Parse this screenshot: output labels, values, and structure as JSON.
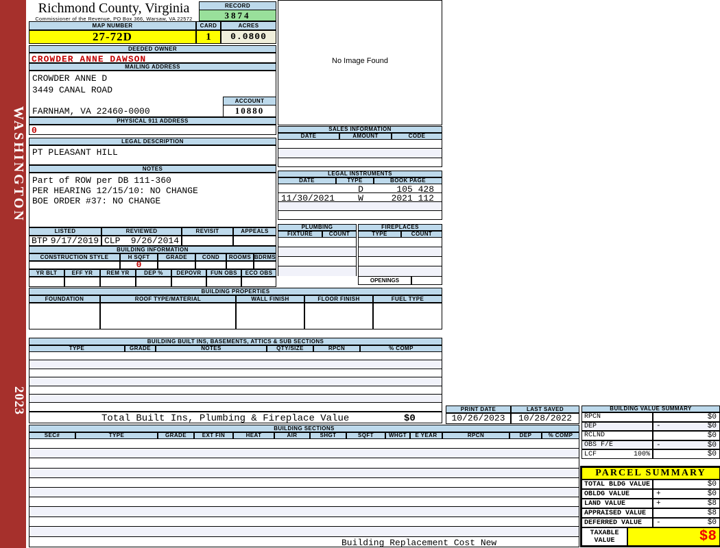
{
  "sidebar": {
    "state": "WASHINGTON",
    "year": "2023"
  },
  "header": {
    "county": "Richmond County, Virginia",
    "office_line": "Commissioner of the Revenue, PO Box 366, Warsaw, VA 22572",
    "record": {
      "label": "RECORD",
      "value": "3874"
    },
    "map_number": {
      "label": "MAP NUMBER",
      "value": "27-72D"
    },
    "card": {
      "label": "CARD",
      "value": "1"
    },
    "acres": {
      "label": "ACRES",
      "value": "0.0800"
    }
  },
  "owner": {
    "deeded_owner_label": "DEEDED OWNER",
    "deeded_owner": "CROWDER ANNE DAWSON",
    "mailing_label": "MAILING ADDRESS",
    "mailing_line1": "CROWDER ANNE D",
    "mailing_line2": "3449 CANAL ROAD",
    "mailing_line3": "FARNHAM, VA 22460-0000",
    "account_label": "ACCOUNT",
    "account": "10880",
    "physical_label": "PHYSICAL 911 ADDRESS",
    "physical_value": "0",
    "legal_label": "LEGAL DESCRIPTION",
    "legal_description": "PT PLEASANT HILL",
    "notes_label": "NOTES",
    "notes_line1": "Part of ROW per DB 111-360",
    "notes_line2": "PER HEARING 12/15/10: NO CHANGE",
    "notes_line3": "BOE ORDER #37: NO CHANGE"
  },
  "review": {
    "headers": [
      "LISTED",
      "REVIEWED",
      "REVISIT",
      "APPEALS"
    ],
    "listed_by": "BTP",
    "listed_date": "9/17/2019",
    "reviewed_by": "CLP",
    "reviewed_date": "9/26/2014"
  },
  "building_information": {
    "title": "BUILDING INFORMATION",
    "row1_headers": [
      "CONSTRUCTION STYLE",
      "H SQFT",
      "GRADE",
      "COND",
      "ROOMS",
      "BDRMS"
    ],
    "h_sqft": "0",
    "row2_headers": [
      "YR BLT",
      "EFF YR",
      "REM YR",
      "DEP %",
      "DEPOVR",
      "FUN OBS",
      "ECO OBS"
    ]
  },
  "building_properties": {
    "title": "BUILDING PROPERTIES",
    "headers": [
      "FOUNDATION",
      "ROOF TYPE/MATERIAL",
      "WALL FINISH",
      "FLOOR FINISH",
      "FUEL TYPE"
    ]
  },
  "built_ins": {
    "title": "BUILDING BUILT INS, BASEMENTS, ATTICS & SUB SECTIONS",
    "headers": [
      "TYPE",
      "GRADE",
      "NOTES",
      "QTY/SIZE",
      "RPCN",
      "% COMP"
    ],
    "total_label": "Total Built Ins, Plumbing & Fireplace Value",
    "total_value": "$0"
  },
  "photo": {
    "placeholder": "No Image Found"
  },
  "sales": {
    "title": "SALES INFORMATION",
    "headers": [
      "DATE",
      "AMOUNT",
      "CODE"
    ]
  },
  "legal_instruments": {
    "title": "LEGAL INSTRUMENTS",
    "headers": [
      "DATE",
      "TYPE",
      "BOOK PAGE"
    ],
    "rows": [
      {
        "date": "",
        "type": "D",
        "book_page": "105 428"
      },
      {
        "date": "11/30/2021",
        "type": "W",
        "book_page": "2021 112"
      }
    ]
  },
  "plumbing": {
    "title": "PLUMBING",
    "headers": [
      "FIXTURE",
      "COUNT"
    ]
  },
  "fireplaces": {
    "title": "FIREPLACES",
    "headers": [
      "TYPE",
      "COUNT"
    ],
    "openings_label": "OPENINGS"
  },
  "print_info": {
    "print_date_label": "PRINT DATE",
    "print_date": "10/26/2023",
    "last_saved_label": "LAST SAVED",
    "last_saved": "10/28/2022"
  },
  "building_value_summary": {
    "title": "BUILDING VALUE SUMMARY",
    "rows": [
      {
        "label": "RPCN",
        "pct": "",
        "op": "",
        "value": "$0"
      },
      {
        "label": "DEP",
        "pct": "",
        "op": "-",
        "value": "$0"
      },
      {
        "label": "RCLND",
        "pct": "",
        "op": "",
        "value": "$0"
      },
      {
        "label": "OBS F/E",
        "pct": "",
        "op": "-",
        "value": "$0"
      },
      {
        "label": "LCF",
        "pct": "100%",
        "op": "",
        "value": "$0"
      }
    ]
  },
  "building_sections": {
    "title": "BUILDING SECTIONS",
    "headers": [
      "SEC#",
      "TYPE",
      "GRADE",
      "EXT FIN",
      "HEAT",
      "AIR",
      "SHGT",
      "SQFT",
      "WHGT",
      "E YEAR",
      "RPCN",
      "DEP",
      "% COMP"
    ],
    "footer_label": "Building Replacement Cost New"
  },
  "parcel_summary": {
    "title": "PARCEL SUMMARY",
    "rows": [
      {
        "label": "TOTAL BLDG VALUE",
        "op": "",
        "value": "$0"
      },
      {
        "label": "OBLDG VALUE",
        "op": "+",
        "value": "$0"
      },
      {
        "label": "LAND VALUE",
        "op": "+",
        "value": "$8"
      },
      {
        "label": "APPRAISED VALUE",
        "op": "",
        "value": "$8"
      },
      {
        "label": "DEFERRED VALUE",
        "op": "-",
        "value": "$0"
      }
    ],
    "taxable_label_line1": "TAXABLE",
    "taxable_label_line2": "VALUE",
    "taxable_value": "$8"
  },
  "colors": {
    "spine_red": "#A6302C",
    "header_blue": "#BDD9EB",
    "record_green": "#99E09B",
    "accent_yellow": "#FFFF00",
    "alert_red": "#C00000",
    "taxable_red": "#EE0000"
  }
}
